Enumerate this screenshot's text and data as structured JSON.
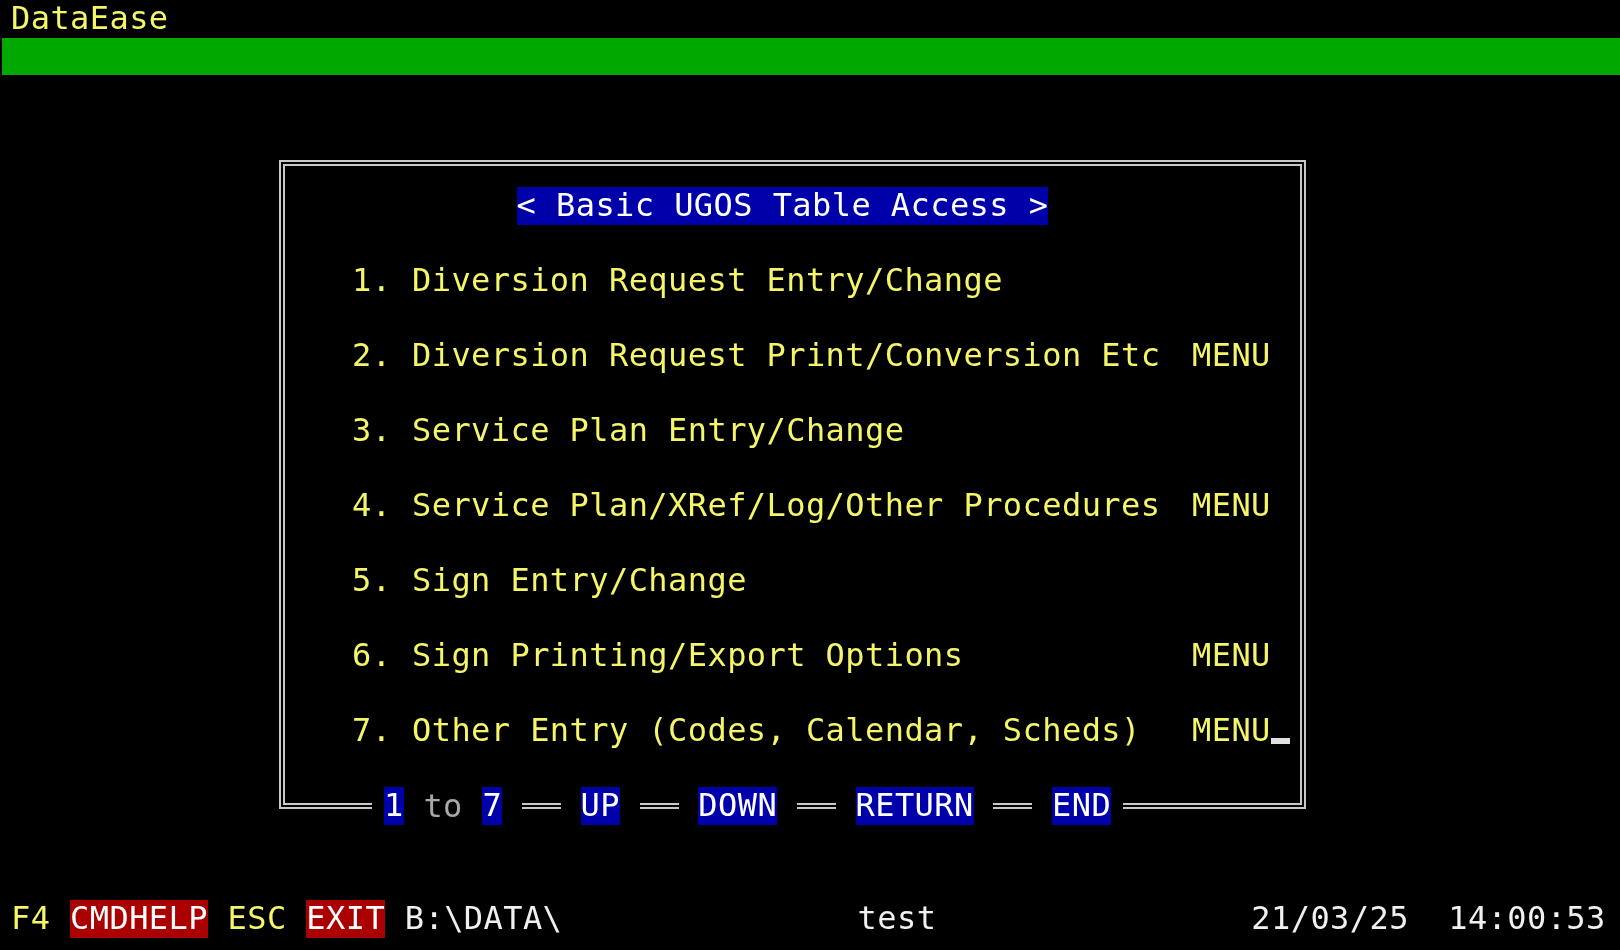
{
  "app_title": "DataEase",
  "menu": {
    "title": "< Basic UGOS Table Access >",
    "items": [
      {
        "number": "1.",
        "label": "Diversion Request Entry/Change",
        "cursor": false
      },
      {
        "number": "2.",
        "label": "Diversion Request Print/Conversion Etc",
        "tag": "MENU",
        "cursor": false
      },
      {
        "number": "3.",
        "label": "Service Plan Entry/Change",
        "cursor": false
      },
      {
        "number": "4.",
        "label": "Service Plan/XRef/Log/Other Procedures",
        "tag": "MENU",
        "cursor": false
      },
      {
        "number": "5.",
        "label": "Sign Entry/Change",
        "cursor": false
      },
      {
        "number": "6.",
        "label": "Sign Printing/Export Options",
        "tag": "MENU",
        "cursor": false
      },
      {
        "number": "7.",
        "label": "Other Entry (Codes, Calendar, Scheds)",
        "tag": "MENU",
        "cursor": true
      }
    ],
    "keys": [
      {
        "kind": "key",
        "text": "1"
      },
      {
        "kind": "word",
        "text": "to"
      },
      {
        "kind": "key",
        "text": "7"
      },
      {
        "kind": "separator"
      },
      {
        "kind": "key",
        "text": "UP"
      },
      {
        "kind": "separator"
      },
      {
        "kind": "key",
        "text": "DOWN"
      },
      {
        "kind": "separator"
      },
      {
        "kind": "key",
        "text": "RETURN"
      },
      {
        "kind": "separator"
      },
      {
        "kind": "key",
        "text": "END"
      }
    ]
  },
  "status_bar": [
    {
      "kind": "key",
      "text": "F4"
    },
    {
      "kind": "action",
      "text": "CMDHELP"
    },
    {
      "kind": "key",
      "text": "ESC"
    },
    {
      "kind": "action",
      "text": "EXIT"
    },
    {
      "kind": "text",
      "text": "B:\\DATA\\"
    },
    {
      "kind": "text",
      "text": "test"
    },
    {
      "kind": "text",
      "text": "21/03/25"
    },
    {
      "kind": "text",
      "text": "14:00:53"
    }
  ]
}
